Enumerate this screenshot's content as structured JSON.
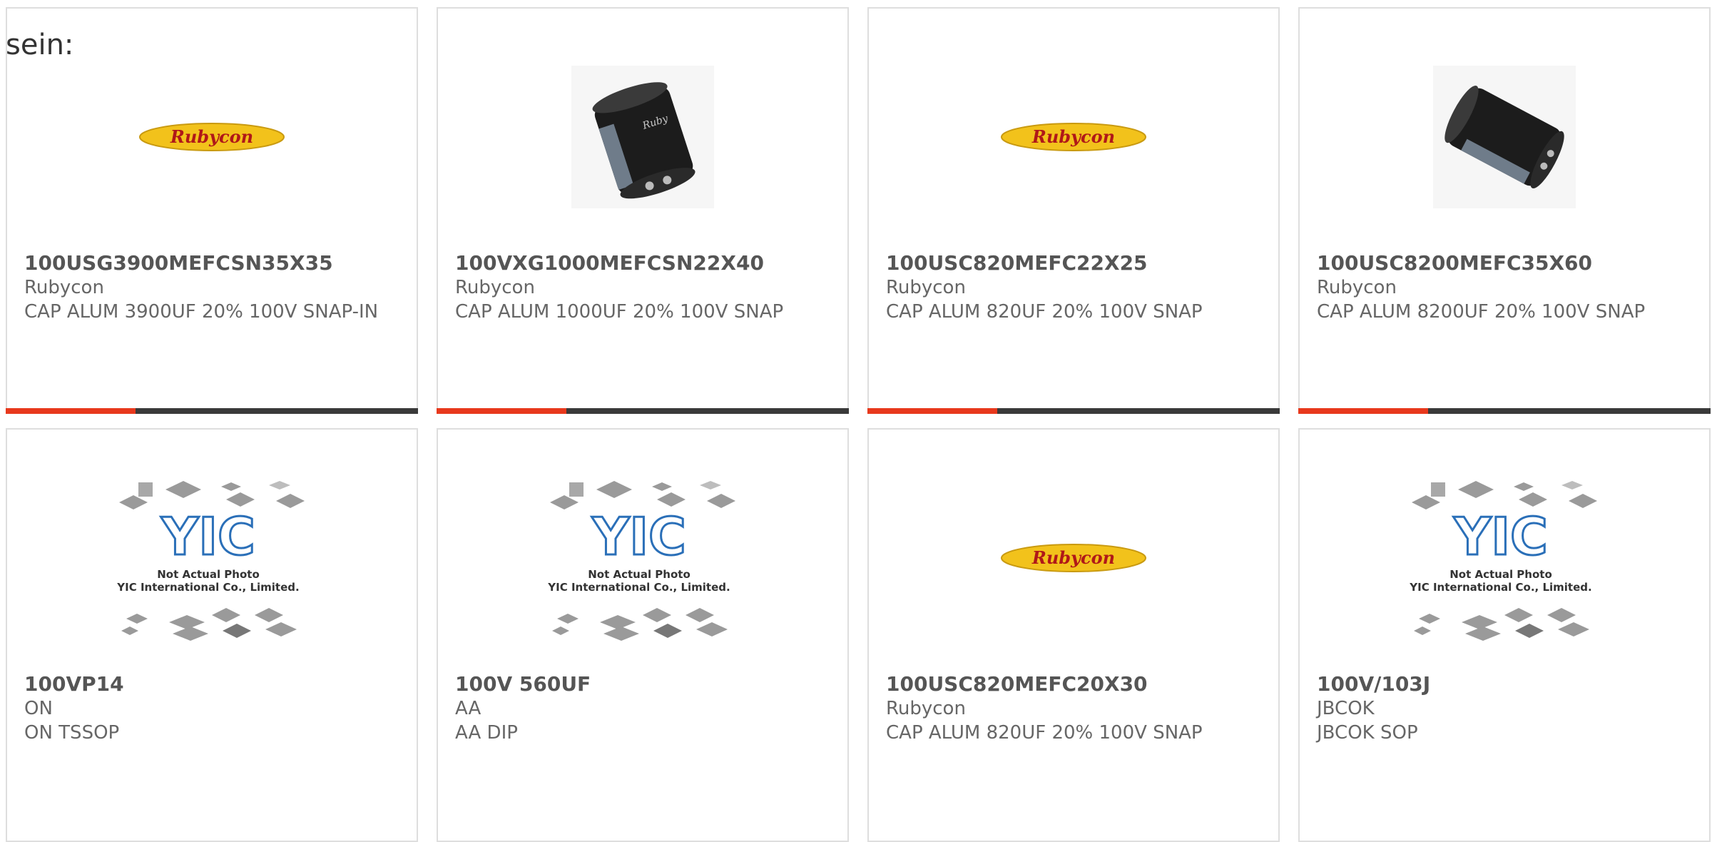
{
  "intro": {
    "text": "sein:"
  },
  "colors": {
    "accent": "#e8391d",
    "bar": "#3a3a3a",
    "border": "#dedede",
    "text": "#555555"
  },
  "products": [
    {
      "part": "100USG3900MEFCSN35X35",
      "manufacturer": "Rubycon",
      "description": "CAP ALUM 3900UF 20% 100V SNAP-IN",
      "image": "rubycon-logo",
      "logo_text": "Rubycon"
    },
    {
      "part": "100VXG1000MEFCSN22X40",
      "manufacturer": "Rubycon",
      "description": "CAP ALUM 1000UF 20% 100V SNAP",
      "image": "capacitor-photo"
    },
    {
      "part": "100USC820MEFC22X25",
      "manufacturer": "Rubycon",
      "description": "CAP ALUM 820UF 20% 100V SNAP",
      "image": "rubycon-logo",
      "logo_text": "Rubycon"
    },
    {
      "part": "100USC8200MEFC35X60",
      "manufacturer": "Rubycon",
      "description": "CAP ALUM 8200UF 20% 100V SNAP",
      "image": "capacitor-photo"
    },
    {
      "part": "100VP14",
      "manufacturer": "ON",
      "description": "ON TSSOP",
      "image": "placeholder",
      "ph_logo": "YIC",
      "ph_line1": "Not Actual Photo",
      "ph_line2": "YIC International Co., Limited."
    },
    {
      "part": "100V 560UF",
      "manufacturer": "AA",
      "description": "AA DIP",
      "image": "placeholder",
      "ph_logo": "YIC",
      "ph_line1": "Not Actual Photo",
      "ph_line2": "YIC International Co., Limited."
    },
    {
      "part": "100USC820MEFC20X30",
      "manufacturer": "Rubycon",
      "description": "CAP ALUM 820UF 20% 100V SNAP",
      "image": "rubycon-logo",
      "logo_text": "Rubycon"
    },
    {
      "part": "100V/103J",
      "manufacturer": "JBCOK",
      "description": "JBCOK SOP",
      "image": "placeholder",
      "ph_logo": "YIC",
      "ph_line1": "Not Actual Photo",
      "ph_line2": "YIC International Co., Limited."
    }
  ]
}
